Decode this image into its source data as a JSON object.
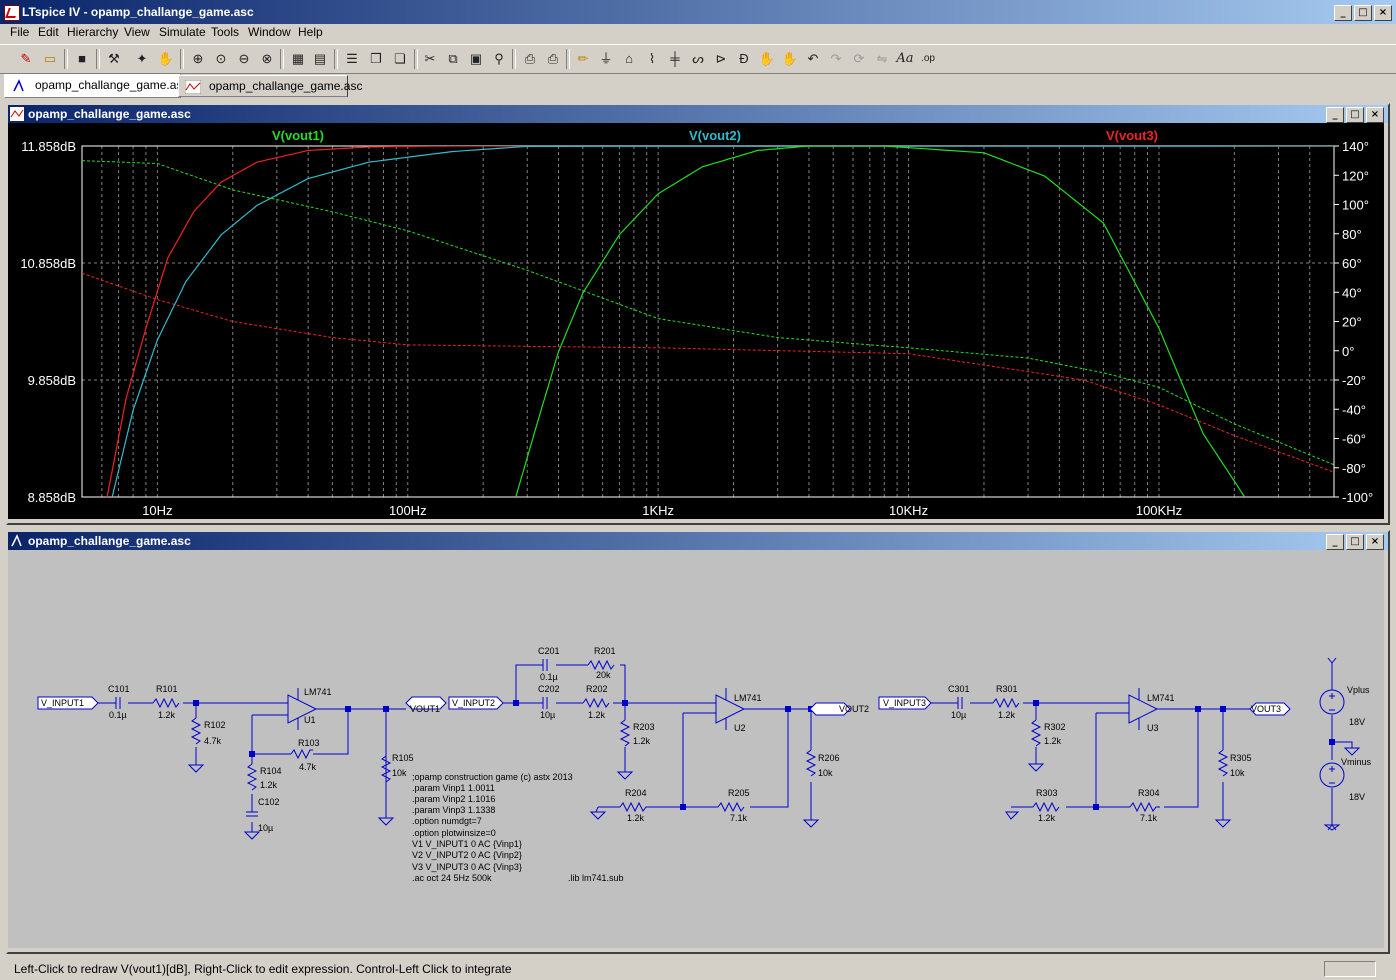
{
  "app": {
    "title": "LTspice IV - opamp_challange_game.asc"
  },
  "window_controls": [
    "_",
    "□",
    "×"
  ],
  "menu": [
    "File",
    "Edit",
    "Hierarchy",
    "View",
    "Simulate",
    "Tools",
    "Window",
    "Help"
  ],
  "tabs": [
    {
      "label": "opamp_challange_game.asc",
      "kind": "schematic",
      "active": true
    },
    {
      "label": "opamp_challange_game.asc",
      "kind": "waveform",
      "active": false
    }
  ],
  "plot_window": {
    "title": "opamp_challange_game.asc"
  },
  "schematic_window": {
    "title": "opamp_challange_game.asc"
  },
  "colors": {
    "vout1": "#22dd22",
    "vout2": "#33bbcc",
    "vout3": "#ee2222",
    "wire": "#0000cc",
    "plot_bg": "#000000"
  },
  "chart_data": {
    "type": "line",
    "title": "",
    "x_scale": "log",
    "xlim": [
      5,
      500000
    ],
    "x_ticks": [
      "10Hz",
      "100Hz",
      "1KHz",
      "10KHz",
      "100KHz"
    ],
    "x_tick_values": [
      10,
      100,
      1000,
      10000,
      100000
    ],
    "y_left_ticks": [
      "11.858dB",
      "10.858dB",
      "9.858dB",
      "8.858dB"
    ],
    "y_left_values": [
      11.858,
      10.858,
      9.858,
      8.858
    ],
    "ylim_left": [
      8.858,
      11.858
    ],
    "y_right_ticks": [
      "140°",
      "120°",
      "100°",
      "80°",
      "60°",
      "40°",
      "20°",
      "0°",
      "-20°",
      "-40°",
      "-60°",
      "-80°",
      "-100°"
    ],
    "y_right_values": [
      140,
      120,
      100,
      80,
      60,
      40,
      20,
      0,
      -20,
      -40,
      -60,
      -80,
      -100
    ],
    "ylim_right": [
      -100,
      140
    ],
    "grid": true,
    "series": [
      {
        "name": "V(vout1)",
        "color": "#ee2222",
        "mag_db": [
          [
            6.3,
            8.858
          ],
          [
            7.5,
            9.7
          ],
          [
            9,
            10.3
          ],
          [
            11,
            10.9
          ],
          [
            14,
            11.3
          ],
          [
            18,
            11.55
          ],
          [
            25,
            11.72
          ],
          [
            40,
            11.82
          ],
          [
            70,
            11.85
          ],
          [
            150,
            11.858
          ],
          [
            500000,
            11.858
          ]
        ],
        "phase_deg": [
          [
            5,
            53
          ],
          [
            10,
            35
          ],
          [
            20,
            20
          ],
          [
            50,
            9
          ],
          [
            100,
            4
          ],
          [
            1000,
            2
          ],
          [
            10000,
            -2
          ],
          [
            50000,
            -20
          ],
          [
            100000,
            -37
          ],
          [
            200000,
            -58
          ],
          [
            500000,
            -83
          ]
        ]
      },
      {
        "name": "V(vout2)",
        "color": "#33bbcc",
        "mag_db": [
          [
            6.6,
            8.858
          ],
          [
            8,
            9.6
          ],
          [
            10,
            10.2
          ],
          [
            13,
            10.7
          ],
          [
            18,
            11.1
          ],
          [
            25,
            11.35
          ],
          [
            40,
            11.58
          ],
          [
            70,
            11.72
          ],
          [
            150,
            11.81
          ],
          [
            300,
            11.855
          ],
          [
            500000,
            11.858
          ]
        ],
        "phase_deg": []
      },
      {
        "name": "V(vout3)",
        "color": "#22dd22",
        "mag_db": [
          [
            270,
            8.858
          ],
          [
            330,
            9.5
          ],
          [
            400,
            10.1
          ],
          [
            500,
            10.6
          ],
          [
            700,
            11.1
          ],
          [
            1000,
            11.45
          ],
          [
            1500,
            11.68
          ],
          [
            2500,
            11.82
          ],
          [
            4000,
            11.858
          ],
          [
            8000,
            11.858
          ],
          [
            20000,
            11.8
          ],
          [
            35000,
            11.6
          ],
          [
            60000,
            11.2
          ],
          [
            100000,
            10.3
          ],
          [
            150000,
            9.4
          ],
          [
            220000,
            8.858
          ]
        ],
        "phase_deg": [
          [
            5,
            130
          ],
          [
            10,
            128
          ],
          [
            20,
            110
          ],
          [
            50,
            95
          ],
          [
            100,
            82
          ],
          [
            300,
            55
          ],
          [
            1000,
            22
          ],
          [
            3000,
            9
          ],
          [
            10000,
            2
          ],
          [
            30000,
            -5
          ],
          [
            60000,
            -15
          ],
          [
            100000,
            -25
          ],
          [
            200000,
            -50
          ],
          [
            500000,
            -78
          ]
        ]
      }
    ],
    "mag_label_series": [
      "V(vout1)",
      "V(vout2)",
      "V(vout3)"
    ]
  },
  "schematic": {
    "ports": [
      "V_INPUT1",
      "V_INPUT2",
      "V_INPUT3",
      "VOUT1",
      "VOUT2",
      "VOUT3"
    ],
    "stage1": {
      "C101": [
        "C101",
        "0.1µ"
      ],
      "R101": [
        "R101",
        "1.2k"
      ],
      "R102": [
        "R102",
        "4.7k"
      ],
      "R103": [
        "R103",
        "4.7k"
      ],
      "R104": [
        "R104",
        "1.2k"
      ],
      "C102": [
        "C102",
        "10µ"
      ],
      "R105": [
        "R105",
        "10k"
      ],
      "opamp": [
        "LM741",
        "U1"
      ]
    },
    "stage2": {
      "C201": [
        "C201",
        "0.1µ"
      ],
      "R201": [
        "R201",
        "20k"
      ],
      "C202": [
        "C202",
        "10µ"
      ],
      "R202": [
        "R202",
        "1.2k"
      ],
      "R203": [
        "R203",
        "1.2k"
      ],
      "R204": [
        "R204",
        "1.2k"
      ],
      "R205": [
        "R205",
        "7.1k"
      ],
      "R206": [
        "R206",
        "10k"
      ],
      "opamp": [
        "LM741",
        "U2"
      ]
    },
    "stage3": {
      "C301": [
        "C301",
        "10µ"
      ],
      "R301": [
        "R301",
        "1.2k"
      ],
      "R302": [
        "R302",
        "1.2k"
      ],
      "R303": [
        "R303",
        "1.2k"
      ],
      "R304": [
        "R304",
        "7.1k"
      ],
      "R305": [
        "R305",
        "10k"
      ],
      "opamp": [
        "LM741",
        "U3"
      ]
    },
    "supplies": {
      "vplus": [
        "Vplus",
        "18V"
      ],
      "vminus": [
        "Vminus",
        "18V"
      ]
    },
    "directives": [
      ";opamp construction game (c) astx 2013",
      ".param Vinp1 1.0011",
      ".param Vinp2 1.1016",
      ".param Vinp3 1.1338",
      ".option numdgt=7",
      ".option plotwinsize=0",
      "V1 V_INPUT1 0 AC {Vinp1}",
      "V2 V_INPUT2 0 AC {Vinp2}",
      "V3 V_INPUT3 0 AC {Vinp3}",
      ".ac oct 24 5Hz 500k"
    ],
    "lib": ".lib lm741.sub"
  },
  "status": {
    "text": "Left-Click to redraw V(vout1)[dB],  Right-Click to edit expression. Control-Left Click to integrate"
  }
}
